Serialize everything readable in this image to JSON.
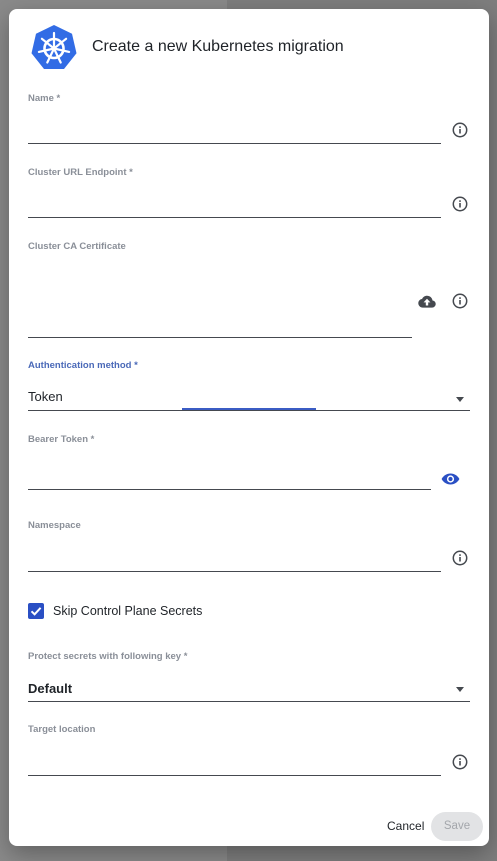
{
  "dialog": {
    "title": "Create a new Kubernetes migration"
  },
  "fields": {
    "name": {
      "label": "Name *",
      "value": ""
    },
    "cluster_url": {
      "label": "Cluster URL Endpoint *",
      "value": ""
    },
    "cluster_ca": {
      "label": "Cluster CA Certificate",
      "value": ""
    },
    "auth_method": {
      "label": "Authentication method *",
      "value": "Token"
    },
    "bearer_token": {
      "label": "Bearer Token *",
      "value": ""
    },
    "namespace": {
      "label": "Namespace",
      "value": ""
    },
    "skip_secrets": {
      "label": "Skip Control Plane Secrets",
      "checked": true
    },
    "protect_key": {
      "label": "Protect secrets with following key *",
      "value": "Default"
    },
    "target_location": {
      "label": "Target location",
      "value": ""
    }
  },
  "actions": {
    "cancel_label": "Cancel",
    "save_label": "Save"
  },
  "colors": {
    "accent": "#2a4fc4",
    "kubernetes_blue": "#326ce5"
  },
  "icons": [
    "kubernetes-logo",
    "info-icon",
    "cloud-upload-icon",
    "eye-icon",
    "chevron-down-icon",
    "check-icon"
  ]
}
